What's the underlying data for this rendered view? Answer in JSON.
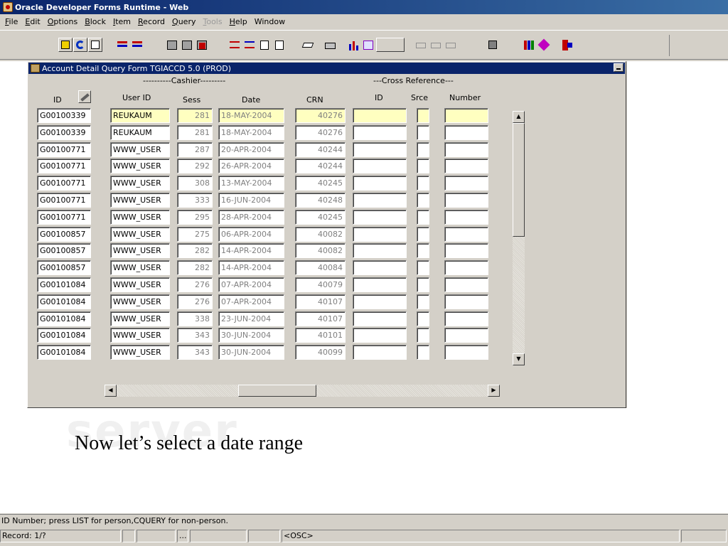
{
  "window": {
    "title": "Oracle Developer Forms Runtime - Web"
  },
  "menu": [
    {
      "label": "File",
      "u": "F",
      "rest": "ile",
      "disabled": false
    },
    {
      "label": "Edit",
      "u": "E",
      "rest": "dit",
      "disabled": false
    },
    {
      "label": "Options",
      "u": "O",
      "rest": "ptions",
      "disabled": false
    },
    {
      "label": "Block",
      "u": "B",
      "rest": "lock",
      "disabled": false
    },
    {
      "label": "Item",
      "u": "I",
      "rest": "tem",
      "disabled": false
    },
    {
      "label": "Record",
      "u": "R",
      "rest": "ecord",
      "disabled": false
    },
    {
      "label": "Query",
      "u": "Q",
      "rest": "uery",
      "disabled": false
    },
    {
      "label": "Tools",
      "u": "T",
      "rest": "ools",
      "disabled": true
    },
    {
      "label": "Help",
      "u": "H",
      "rest": "elp",
      "disabled": false
    },
    {
      "label": "Window",
      "u": "",
      "rest": "Window",
      "disabled": false
    }
  ],
  "form": {
    "title": "Account Detail Query Form  TGIACCD  5.0  (PROD)",
    "group_cashier": "----------Cashier---------",
    "group_xref": "---Cross Reference---",
    "headers": {
      "id": "ID",
      "user_id": "User ID",
      "sess": "Sess",
      "date": "Date",
      "crn": "CRN",
      "xref_id": "ID",
      "srce": "Srce",
      "number": "Number"
    },
    "rows": [
      {
        "id": "G00100339",
        "user": "REUKAUM",
        "sess": "281",
        "date": "18-MAY-2004",
        "crn": "40276"
      },
      {
        "id": "G00100339",
        "user": "REUKAUM",
        "sess": "281",
        "date": "18-MAY-2004",
        "crn": "40276"
      },
      {
        "id": "G00100771",
        "user": "WWW_USER",
        "sess": "287",
        "date": "20-APR-2004",
        "crn": "40244"
      },
      {
        "id": "G00100771",
        "user": "WWW_USER",
        "sess": "292",
        "date": "26-APR-2004",
        "crn": "40244"
      },
      {
        "id": "G00100771",
        "user": "WWW_USER",
        "sess": "308",
        "date": "13-MAY-2004",
        "crn": "40245"
      },
      {
        "id": "G00100771",
        "user": "WWW_USER",
        "sess": "333",
        "date": "16-JUN-2004",
        "crn": "40248"
      },
      {
        "id": "G00100771",
        "user": "WWW_USER",
        "sess": "295",
        "date": "28-APR-2004",
        "crn": "40245"
      },
      {
        "id": "G00100857",
        "user": "WWW_USER",
        "sess": "275",
        "date": "06-APR-2004",
        "crn": "40082"
      },
      {
        "id": "G00100857",
        "user": "WWW_USER",
        "sess": "282",
        "date": "14-APR-2004",
        "crn": "40082"
      },
      {
        "id": "G00100857",
        "user": "WWW_USER",
        "sess": "282",
        "date": "14-APR-2004",
        "crn": "40084"
      },
      {
        "id": "G00101084",
        "user": "WWW_USER",
        "sess": "276",
        "date": "07-APR-2004",
        "crn": "40079"
      },
      {
        "id": "G00101084",
        "user": "WWW_USER",
        "sess": "276",
        "date": "07-APR-2004",
        "crn": "40107"
      },
      {
        "id": "G00101084",
        "user": "WWW_USER",
        "sess": "338",
        "date": "23-JUN-2004",
        "crn": "40107"
      },
      {
        "id": "G00101084",
        "user": "WWW_USER",
        "sess": "343",
        "date": "30-JUN-2004",
        "crn": "40101"
      },
      {
        "id": "G00101084",
        "user": "WWW_USER",
        "sess": "343",
        "date": "30-JUN-2004",
        "crn": "40099"
      }
    ]
  },
  "slide": {
    "caption": "Now let’s select a date range",
    "watermark": "server"
  },
  "hint": "ID Number; press LIST for person,CQUERY for non-person.",
  "status": {
    "record": "Record: 1/?",
    "ellipsis": "...",
    "osc": "<OSC>"
  },
  "colors": {
    "current_row": "#ffffc0",
    "title_bar": "#0a246a",
    "window_bg": "#d4d0c8"
  }
}
